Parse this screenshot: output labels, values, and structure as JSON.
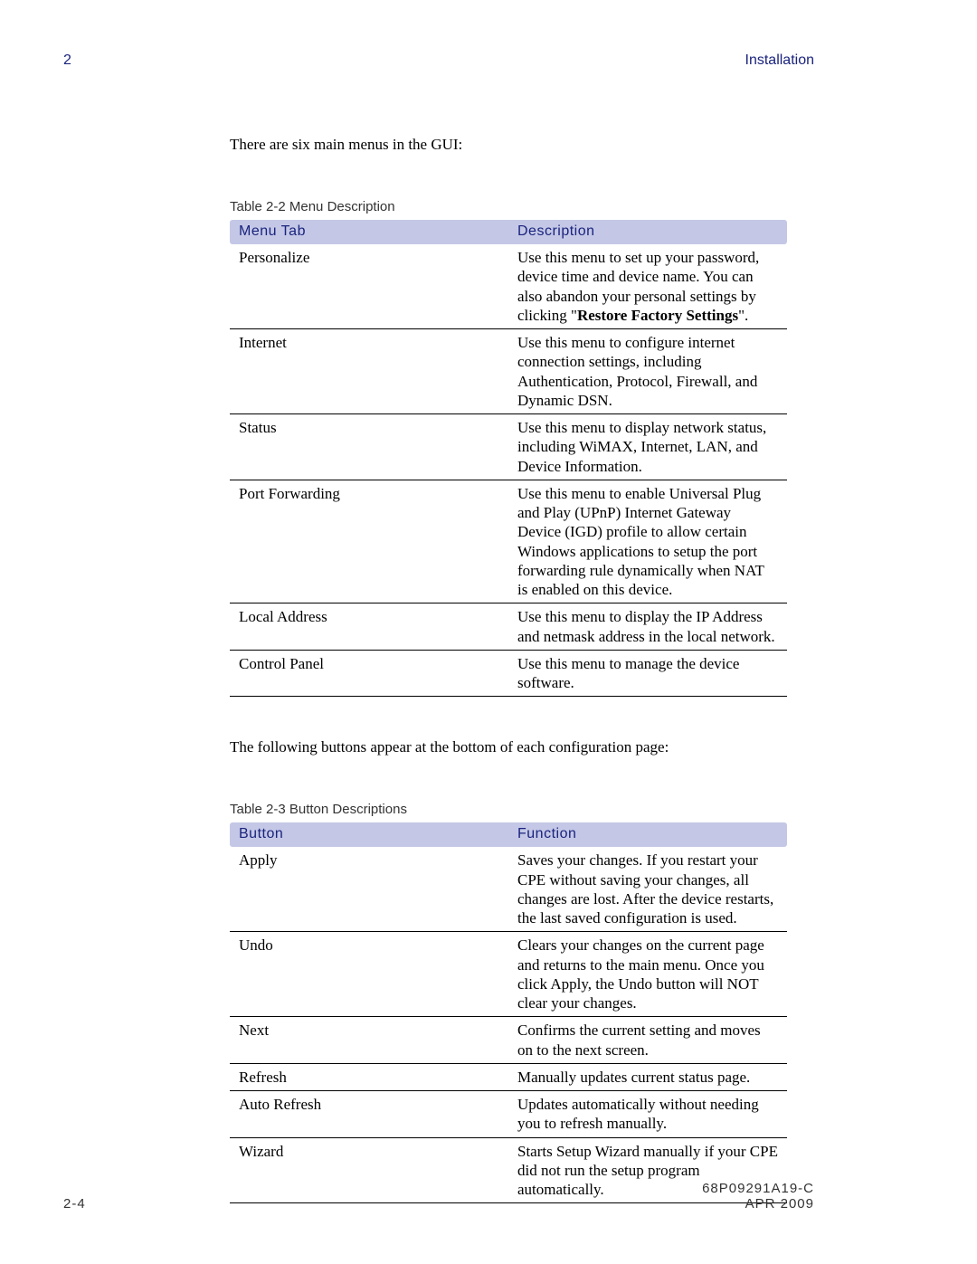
{
  "header": {
    "chapter_number": "2",
    "section_title": "Installation"
  },
  "body": {
    "intro1": "There are six main menus in the GUI:",
    "intro2": "The following buttons appear at the bottom of each configuration page:"
  },
  "table1": {
    "caption": "Table 2-2 Menu Description",
    "head": {
      "col1": "Menu Tab",
      "col2": "Description"
    },
    "rows": [
      {
        "label": "Personalize",
        "desc_pre": "Use this menu to set up your password, device time and device name. You can also abandon your personal settings by clicking \"",
        "desc_bold": "Restore Factory Settings",
        "desc_post": "\"."
      },
      {
        "label": "Internet",
        "desc": "Use this menu to configure internet connection settings, including Authentication, Protocol, Firewall, and Dynamic DSN."
      },
      {
        "label": "Status",
        "desc": "Use this menu to display network status, including WiMAX, Internet, LAN, and Device Information."
      },
      {
        "label": "Port Forwarding",
        "desc": "Use this menu to enable Universal Plug and Play (UPnP) Internet Gateway Device (IGD) profile to allow certain Windows applications to setup the port forwarding rule dynamically when NAT is enabled on this device."
      },
      {
        "label": "Local Address",
        "desc": "Use this menu to display the IP Address and netmask address in the local network."
      },
      {
        "label": "Control Panel",
        "desc": "Use this menu to manage the device software."
      }
    ]
  },
  "table2": {
    "caption": "Table 2-3 Button Descriptions",
    "head": {
      "col1": "Button",
      "col2": "Function"
    },
    "rows": [
      {
        "label": "Apply",
        "desc": "Saves your changes. If you restart your CPE without saving your changes, all changes are lost. After the device restarts, the last saved configuration is used."
      },
      {
        "label": "Undo",
        "desc": "Clears your changes on the current page and returns to the main menu. Once you click Apply, the Undo button will NOT clear your changes."
      },
      {
        "label": "Next",
        "desc": "Confirms the current setting and moves on to the next screen."
      },
      {
        "label": "Refresh",
        "desc": "Manually updates current status page."
      },
      {
        "label": "Auto Refresh",
        "desc": "Updates automatically without needing you to refresh manually."
      },
      {
        "label": "Wizard",
        "desc": "Starts Setup Wizard manually if your CPE did not run the setup program automatically."
      }
    ]
  },
  "footer": {
    "page_local": "2-4",
    "doc_number": "68P09291A19-C",
    "date": "APR 2009"
  }
}
